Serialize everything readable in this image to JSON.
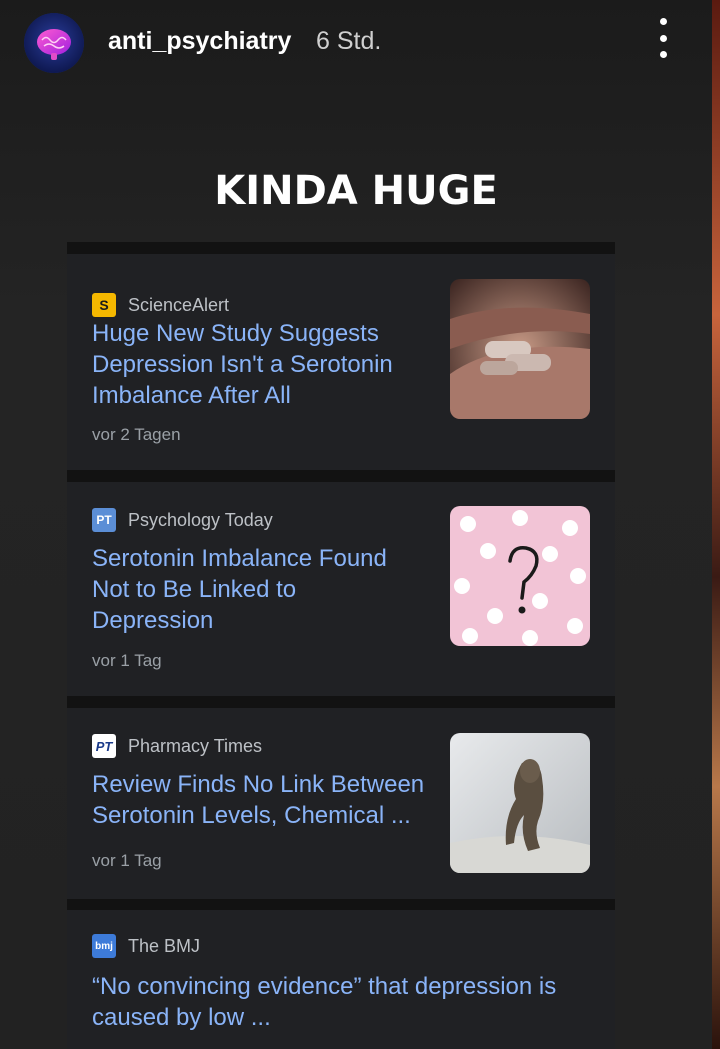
{
  "header": {
    "username": "anti_psychiatry",
    "time_ago": "6 Std.",
    "avatar_icon": "brain-icon",
    "more_icon": "more-vertical-icon"
  },
  "caption": "KINDA HUGE",
  "articles": [
    {
      "source": "ScienceAlert",
      "favicon_text": "S",
      "favicon_bg": "#f5b800",
      "favicon_fg": "#1a1a1a",
      "headline": "Huge New Study Suggests Depression Isn't a Serotonin Imbalance After All",
      "date": "vor 2 Tagen",
      "thumbnail": "pills-in-hand-image"
    },
    {
      "source": "Psychology Today",
      "favicon_text": "PT",
      "favicon_bg": "#5b8ed6",
      "favicon_fg": "#ffffff",
      "headline": "Serotonin Imbalance Found Not to Be Linked to Depression",
      "date": "vor 1 Tag",
      "thumbnail": "question-mark-pills-image"
    },
    {
      "source": "Pharmacy Times",
      "favicon_text": "PT",
      "favicon_bg": "#ffffff",
      "favicon_fg": "#1a3a8a",
      "headline": "Review Finds No Link Between Serotonin Levels, Chemical ...",
      "date": "vor 1 Tag",
      "thumbnail": "thinking-sculpture-image"
    },
    {
      "source": "The BMJ",
      "favicon_text": "bmj",
      "favicon_bg": "#3d7bd9",
      "favicon_fg": "#ffffff",
      "headline": "“No convincing evidence” that depression is caused by low ...",
      "date": "",
      "thumbnail": ""
    }
  ],
  "colors": {
    "headline": "#8ab4f8",
    "card_bg": "#202124",
    "meta": "#9aa0a6"
  }
}
